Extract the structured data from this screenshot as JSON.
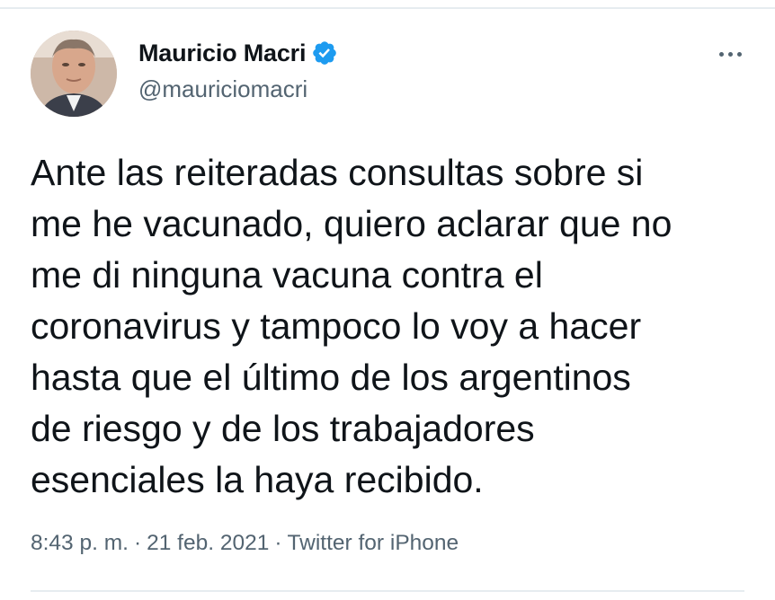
{
  "tweet": {
    "author": {
      "display_name": "Mauricio Macri",
      "handle": "@mauriciomacri",
      "verified_icon": "verified-badge-icon",
      "avatar": "profile-photo"
    },
    "more_icon": "more-horizontal-icon",
    "text_lines": [
      "Ante las reiteradas consultas sobre si",
      "me he vacunado, quiero aclarar que no",
      "me di ninguna vacuna contra el",
      "coronavirus y tampoco lo voy a hacer",
      "hasta que el último de los argentinos",
      "de riesgo y de los trabajadores",
      "esenciales la haya recibido."
    ],
    "time": "8:43 p. m.",
    "separator": "·",
    "date": "21 feb. 2021",
    "source": "Twitter for iPhone"
  },
  "colors": {
    "text_primary": "#0f1419",
    "text_secondary": "#536471",
    "verified_blue": "#1d9bf0",
    "divider": "#e6ecf0"
  }
}
